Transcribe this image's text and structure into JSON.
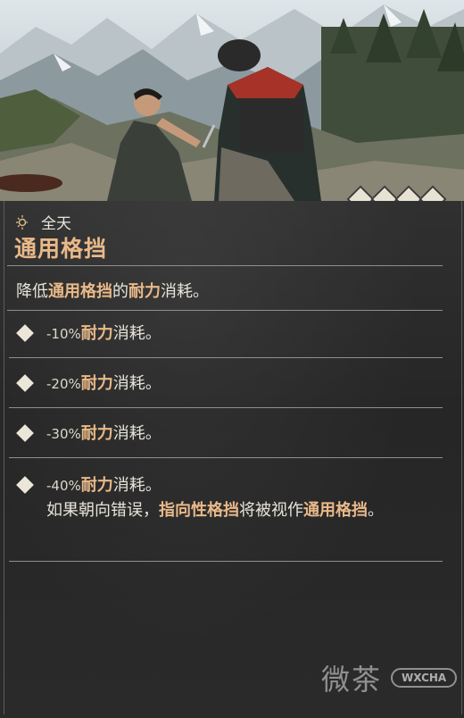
{
  "header": {
    "time_of_day": "全天",
    "skill_name": "通用格挡",
    "tier_count": 4
  },
  "description": {
    "prefix": "降低",
    "hl1": "通用格挡",
    "mid": "的",
    "hl2": "耐力",
    "suffix": "消耗。"
  },
  "tiers": [
    {
      "pct": "-10%",
      "hl": "耐力",
      "suffix": "消耗。"
    },
    {
      "pct": "-20%",
      "hl": "耐力",
      "suffix": "消耗。"
    },
    {
      "pct": "-30%",
      "hl": "耐力",
      "suffix": "消耗。"
    },
    {
      "pct": "-40%",
      "hl": "耐力",
      "suffix": "消耗。",
      "extra_a": "如果朝向错误，",
      "extra_hl1": "指向性格挡",
      "extra_b": "将被视作",
      "extra_hl2": "通用格挡",
      "extra_c": "。"
    }
  ],
  "watermark": {
    "text": "微茶",
    "badge": "WXCHA"
  },
  "colors": {
    "highlight": "#e9b989",
    "panel_bg": "#262626",
    "text": "#e8e4da"
  }
}
